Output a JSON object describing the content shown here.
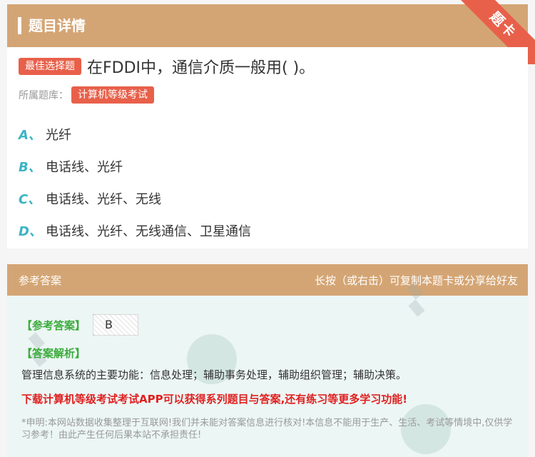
{
  "header": {
    "title": "题目详情",
    "corner_label": "题卡"
  },
  "question": {
    "type_badge": "最佳选择题",
    "text": "在FDDI中，通信介质一般用( )。",
    "bank_label": "所属题库：",
    "bank_name": "计算机等级考试"
  },
  "options": [
    {
      "letter": "A、",
      "text": "光纤"
    },
    {
      "letter": "B、",
      "text": "电话线、光纤"
    },
    {
      "letter": "C、",
      "text": "电话线、光纤、无线"
    },
    {
      "letter": "D、",
      "text": "电话线、光纤、无线通信、卫星通信"
    }
  ],
  "answer": {
    "section_title": "参考答案",
    "share_hint": "长按（或右击）可复制本题卡或分享给好友",
    "answer_label": "【参考答案】",
    "answer_value": "B",
    "analysis_label": "【答案解析】",
    "analysis_text": "管理信息系统的主要功能：信息处理；辅助事务处理，辅助组织管理；辅助决策。",
    "promo": "下载计算机等级考试考试APP可以获得系列题目与答案,还有练习等更多学习功能!",
    "disclaimer": "*申明:本网站数据收集整理于互联网!我们并未能对答案信息进行核对!本信息不能用于生产、生活、考试等情境中,仅供学习参考！由此产生任何后果本站不承担责任!"
  },
  "colors": {
    "brand": "#d4a574",
    "accent": "#e8604a",
    "option_letter": "#3bb4c4",
    "answer_green": "#3bab3b",
    "promo_red": "#e02020"
  }
}
